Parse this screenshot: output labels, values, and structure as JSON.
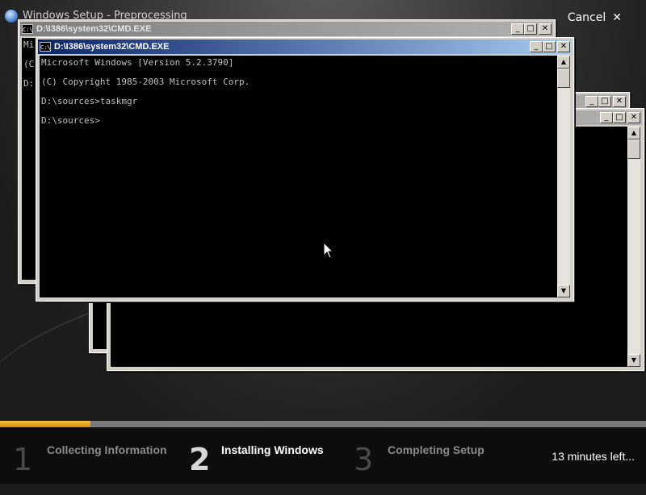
{
  "setup": {
    "title": "Windows Setup - Preprocessing",
    "cancel_label": "Cancel",
    "progress": 0.14
  },
  "windows": {
    "back": {
      "title": "D:\\I386\\system32\\CMD.EXE",
      "lines": [
        "Mi",
        "(C",
        "D:"
      ]
    },
    "front": {
      "title": "D:\\I386\\system32\\CMD.EXE",
      "lines": [
        "Microsoft Windows [Version 5.2.3790]",
        "(C) Copyright 1985-2003 Microsoft Corp.",
        "D:\\sources>taskmgr",
        "D:\\sources>"
      ]
    },
    "title_buttons": {
      "minimize": "_",
      "maximize": "□",
      "close": "✕"
    }
  },
  "steps": [
    {
      "number": "1",
      "label": "Collecting Information",
      "active": false
    },
    {
      "number": "2",
      "label": "Installing Windows",
      "active": true
    },
    {
      "number": "3",
      "label": "Completing Setup",
      "active": false
    }
  ],
  "time_left": "13 minutes left...",
  "icons": {
    "setup": "windows-setup-icon",
    "console": "cmd-icon",
    "cancel": "close-icon"
  }
}
